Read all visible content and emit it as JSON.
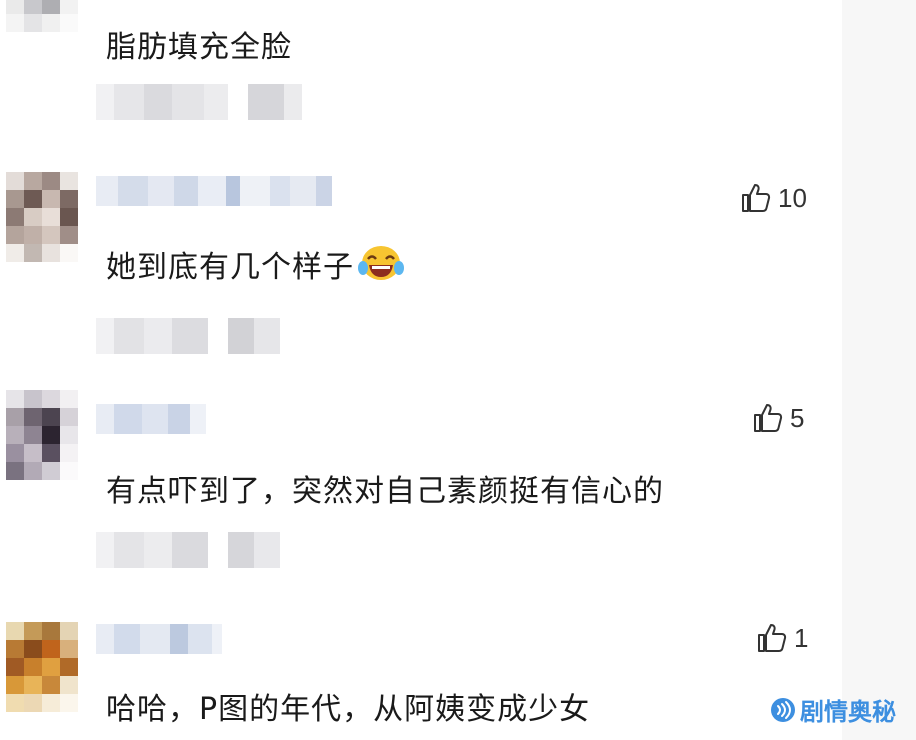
{
  "comments": [
    {
      "text": "脂肪填充全脸",
      "likes": ""
    },
    {
      "text": "她到底有几个样子",
      "likes": "10",
      "emoji": "laughing-crying-emoji"
    },
    {
      "text": "有点吓到了，突然对自己素颜挺有信心的",
      "likes": "5"
    },
    {
      "text": "哈哈，P图的年代，从阿姨变成少女",
      "likes": "1"
    }
  ],
  "watermark": "剧情奥秘",
  "colors": {
    "accent": "#3d8fe0",
    "text": "#1a1a1a",
    "blur_light": "#eeeef2",
    "blur_mid": "#d4d4da"
  }
}
